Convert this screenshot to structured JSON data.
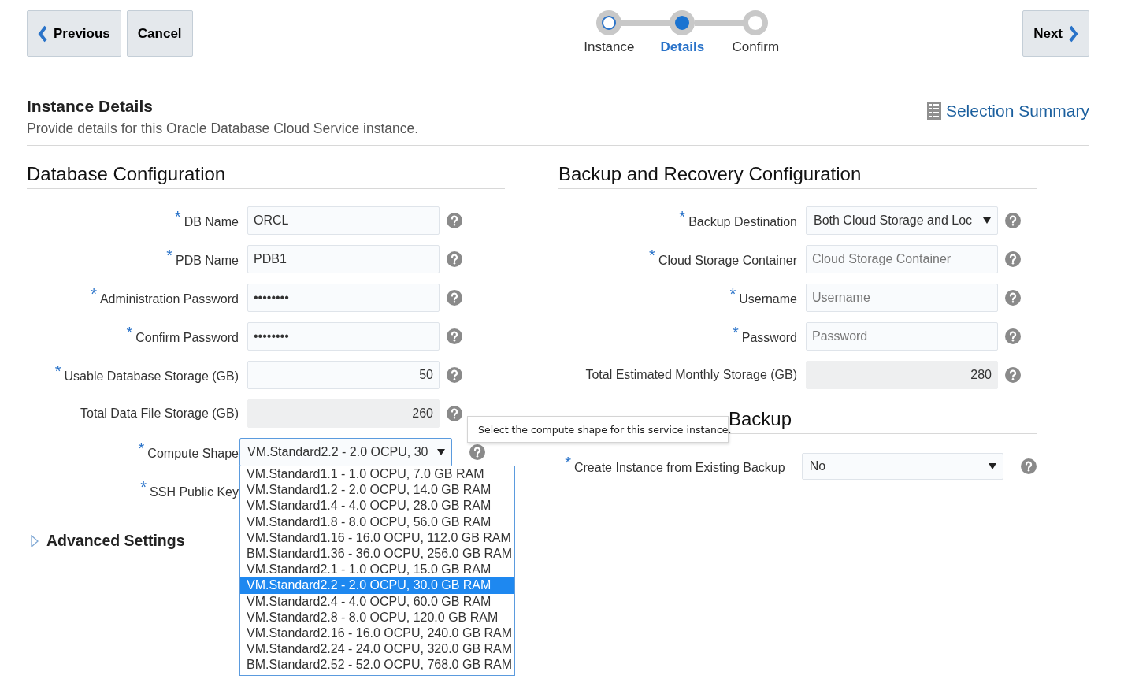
{
  "required_marker": "*",
  "toolbar": {
    "previous": "Previous",
    "cancel": "Cancel",
    "next": "Next"
  },
  "train": [
    {
      "label": "Instance",
      "selected": false,
      "visited": true
    },
    {
      "label": "Details",
      "selected": true,
      "visited": true
    },
    {
      "label": "Confirm",
      "selected": false,
      "visited": false
    }
  ],
  "header": {
    "title": "Instance Details",
    "subtitle": "Provide details for this Oracle Database Cloud Service instance.",
    "summary_link": "Selection Summary"
  },
  "database": {
    "title": "Database Configuration",
    "fields": [
      {
        "label": "DB Name",
        "required": true,
        "kind": "text",
        "value": "ORCL"
      },
      {
        "label": "PDB Name",
        "required": true,
        "kind": "text",
        "value": "PDB1"
      },
      {
        "label": "Administration Password",
        "required": true,
        "kind": "text",
        "value": "••••••••"
      },
      {
        "label": "Confirm Password",
        "required": true,
        "kind": "text",
        "value": "••••••••"
      },
      {
        "label": "Usable Database Storage (GB)",
        "required": true,
        "kind": "number",
        "value": "50"
      },
      {
        "label": "Total Data File Storage (GB)",
        "required": false,
        "kind": "computed",
        "value": "260"
      },
      {
        "label": "Compute Shape",
        "required": true,
        "kind": "select",
        "value": "VM.Standard2.2 - 2.0 OCPU, 30",
        "expanded": true,
        "options": [
          {
            "label": "VM.Standard1.1 - 1.0 OCPU, 7.0 GB RAM",
            "selected": false
          },
          {
            "label": "VM.Standard1.2 - 2.0 OCPU, 14.0 GB RAM",
            "selected": false
          },
          {
            "label": "VM.Standard1.4 - 4.0 OCPU, 28.0 GB RAM",
            "selected": false
          },
          {
            "label": "VM.Standard1.8 - 8.0 OCPU, 56.0 GB RAM",
            "selected": false
          },
          {
            "label": "VM.Standard1.16 - 16.0 OCPU, 112.0 GB RAM",
            "selected": false
          },
          {
            "label": "BM.Standard1.36 - 36.0 OCPU, 256.0 GB RAM",
            "selected": false
          },
          {
            "label": "VM.Standard2.1 - 1.0 OCPU, 15.0 GB RAM",
            "selected": false
          },
          {
            "label": "VM.Standard2.2 - 2.0 OCPU, 30.0 GB RAM",
            "selected": true
          },
          {
            "label": "VM.Standard2.4 - 4.0 OCPU, 60.0 GB RAM",
            "selected": false
          },
          {
            "label": "VM.Standard2.8 - 8.0 OCPU, 120.0 GB RAM",
            "selected": false
          },
          {
            "label": "VM.Standard2.16 - 16.0 OCPU, 240.0 GB RAM",
            "selected": false
          },
          {
            "label": "VM.Standard2.24 - 24.0 OCPU, 320.0 GB RAM",
            "selected": false
          },
          {
            "label": "BM.Standard2.52 - 52.0 OCPU, 768.0 GB RAM",
            "selected": false
          }
        ]
      },
      {
        "label": "SSH Public Key",
        "required": true,
        "kind": "covered"
      }
    ]
  },
  "tooltip": "Select the compute shape for this service instance.",
  "advanced": {
    "label": "Advanced Settings",
    "expanded": false
  },
  "backup": {
    "title": "Backup and Recovery Configuration",
    "fields": [
      {
        "label": "Backup Destination",
        "required": true,
        "kind": "select",
        "value": "Both Cloud Storage and Loc",
        "expanded": false
      },
      {
        "label": "Cloud Storage Container",
        "required": true,
        "kind": "text",
        "placeholder": "Cloud Storage Container"
      },
      {
        "label": "Username",
        "required": true,
        "kind": "text",
        "placeholder": "Username"
      },
      {
        "label": "Password",
        "required": true,
        "kind": "text",
        "placeholder": "Password"
      },
      {
        "label": "Total Estimated Monthly Storage (GB)",
        "required": false,
        "kind": "computed",
        "value": "280"
      }
    ]
  },
  "initialize": {
    "title": "Backup",
    "fields": [
      {
        "label": "Create Instance from Existing Backup",
        "required": true,
        "kind": "select",
        "value": "No",
        "expanded": false
      }
    ]
  }
}
